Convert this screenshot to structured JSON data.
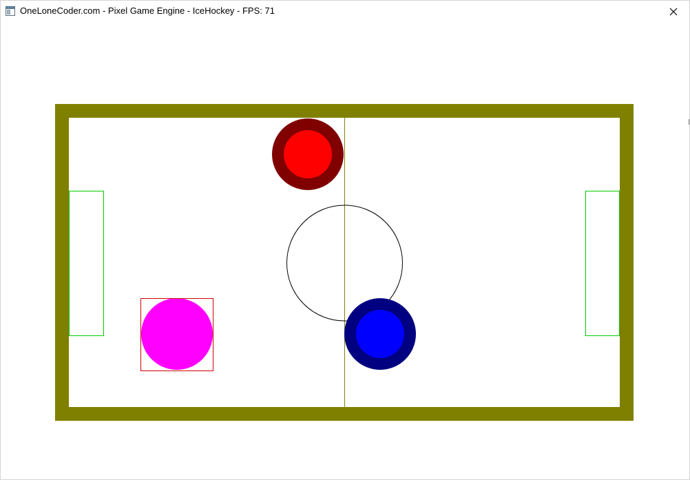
{
  "window": {
    "title": "OneLoneCoder.com - Pixel Game Engine - IceHockey - FPS: 71",
    "icon": "app-window-icon",
    "close_icon": "close-icon"
  },
  "game": {
    "name": "IceHockey",
    "fps": 71,
    "colors": {
      "background": "#ffffff",
      "boundary": "#808000",
      "rink": "#ffffff",
      "center_line": "#808000",
      "center_circle": "#000000",
      "goal_outline": "#00cc00",
      "player_red_outer": "#800000",
      "player_red_inner": "#ff0000",
      "player_blue_outer": "#000080",
      "player_blue_inner": "#0000ff",
      "puck": "#ff00ff",
      "puck_box": "#cc0000"
    }
  }
}
